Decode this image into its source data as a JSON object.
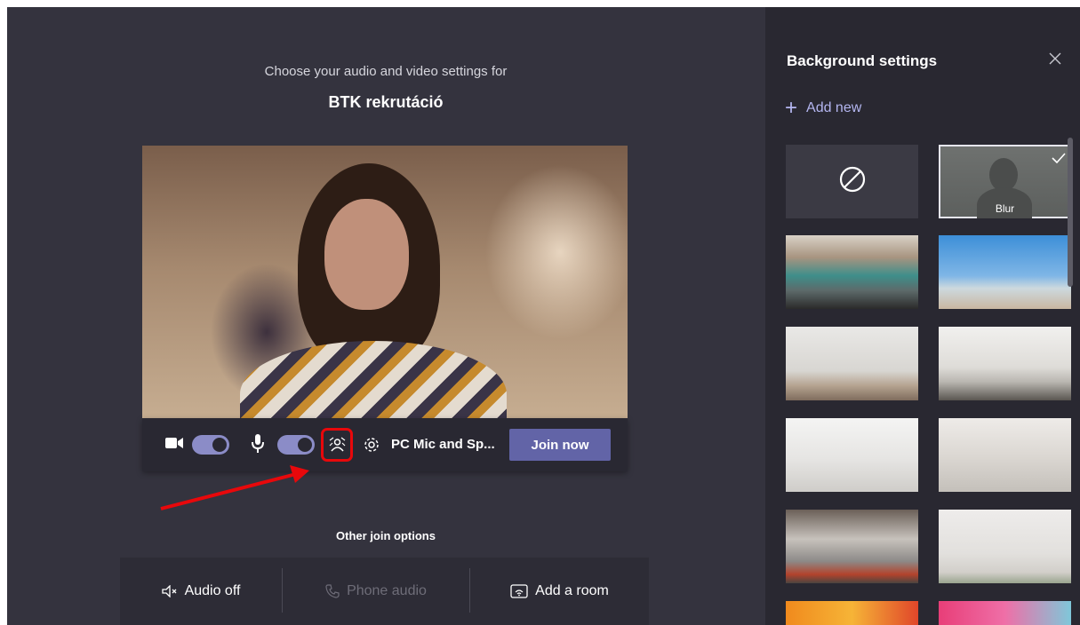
{
  "prejoin": {
    "prompt": "Choose your audio and video settings for",
    "meeting_title": "BTK rekrutáció",
    "device_label": "PC Mic and Sp...",
    "join_label": "Join now",
    "camera_on": true,
    "mic_on": true
  },
  "other_options": {
    "heading": "Other join options",
    "audio_off": "Audio off",
    "phone_audio": "Phone audio",
    "add_room": "Add a room"
  },
  "panel": {
    "title": "Background settings",
    "add_new": "Add new",
    "blur_label": "Blur",
    "selected": "Blur"
  },
  "colors": {
    "accent": "#6264a7",
    "highlight": "#e8080b",
    "background": "#34333e",
    "panel": "#292831"
  },
  "icons": [
    "video-camera-icon",
    "microphone-icon",
    "background-effects-icon",
    "settings-gear-icon",
    "speaker-off-icon",
    "phone-icon",
    "cast-icon",
    "close-icon",
    "plus-icon",
    "none-icon",
    "checkmark-icon"
  ]
}
